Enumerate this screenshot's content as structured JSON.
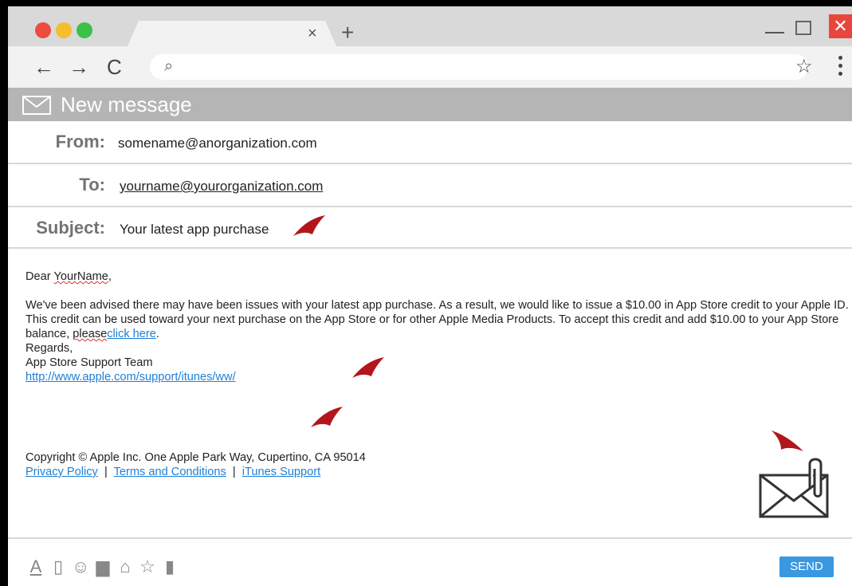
{
  "window": {
    "controls": {
      "close": "×",
      "new_tab": "+",
      "win_close": "✕"
    }
  },
  "addressbar": {
    "back": "←",
    "forward": "→",
    "reload": "C",
    "search_glyph": "⌕",
    "bookmark": "☆"
  },
  "message": {
    "header_title": "New message",
    "from_label": "From:",
    "from_value": "somename@anorganization.com",
    "to_label": "To:",
    "to_value": "yourname@yourorganization.com",
    "subject_label": "Subject:",
    "subject_value": "Your latest app purchase"
  },
  "body": {
    "greeting_prefix": "Dear ",
    "greeting_name": "YourName",
    "greeting_suffix": ",",
    "para1": "We've been advised there may have been issues with your latest app purchase. As a result, we would like to issue a $10.00 in App Store credit to your Apple ID.",
    "para2": "This credit can be used toward your next purchase on the App Store or for other Apple Media Products. To accept this credit and add $10.00 to your App Store balance, ",
    "please": "please",
    "click_here": "click here",
    "period": ".",
    "regards": "Regards,",
    "team": "App Store Support Team",
    "support_url": "http://www.apple.com/support/itunes/ww/"
  },
  "footer": {
    "copyright": "Copyright © Apple Inc. One Apple Park Way, Cupertino, CA 95014",
    "links": [
      "Privacy Policy",
      "Terms and Conditions",
      "iTunes Support"
    ],
    "separator": "|"
  },
  "toolbar": {
    "icons": [
      "A",
      "▯",
      "☺",
      "▆",
      "⌂",
      "☆",
      "▮"
    ],
    "send_label": "SEND"
  },
  "colors": {
    "flag": "#b3151a",
    "accent": "#3a98e0",
    "link": "#1e7fd6"
  }
}
